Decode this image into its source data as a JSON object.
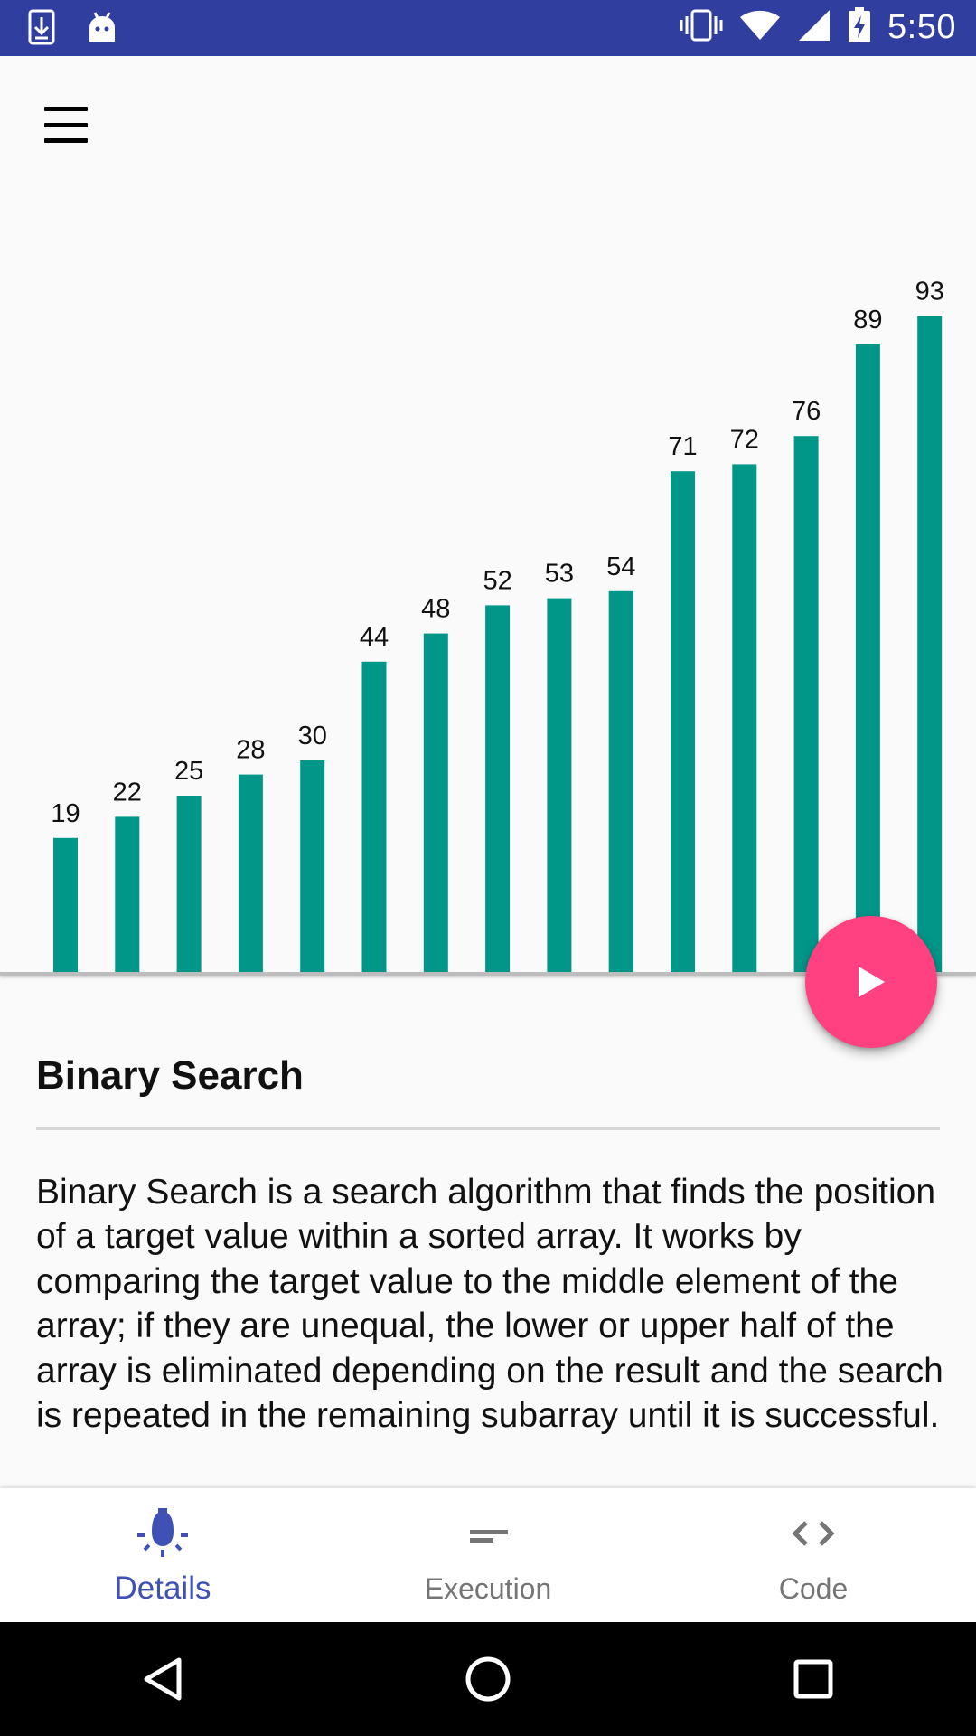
{
  "status_bar": {
    "time": "5:50",
    "icons": [
      "download-icon",
      "android-icon",
      "vibrate-icon",
      "wifi-icon",
      "signal-icon",
      "battery-charging-icon"
    ]
  },
  "app_bar": {
    "menu_icon": "menu-icon"
  },
  "chart_data": {
    "type": "bar",
    "title": "",
    "xlabel": "",
    "ylabel": "",
    "values": [
      19,
      22,
      25,
      28,
      30,
      44,
      48,
      52,
      53,
      54,
      71,
      72,
      76,
      89,
      93
    ],
    "labels": [
      "19",
      "22",
      "25",
      "28",
      "30",
      "44",
      "48",
      "52",
      "53",
      "54",
      "71",
      "72",
      "76",
      "89",
      "93"
    ],
    "bar_color": "#009688",
    "grid": false,
    "legend": "none"
  },
  "fab": {
    "icon": "play-icon",
    "color": "#ff4081"
  },
  "algorithm": {
    "title": "Binary Search",
    "description": "Binary Search is a search algorithm that finds the position of a target value within a sorted array. It works by comparing the target value to the middle element of the array; if they are unequal, the lower or upper half of the array is eliminated depending on the result and the search is repeated in the remaining subarray until it is successful."
  },
  "bottom_nav": {
    "items": [
      {
        "label": "Details",
        "icon": "bulb-icon",
        "active": true
      },
      {
        "label": "Execution",
        "icon": "execution-icon",
        "active": false
      },
      {
        "label": "Code",
        "icon": "code-icon",
        "active": false
      }
    ],
    "active_color": "#3f51b5",
    "inactive_color": "#757575"
  },
  "system_nav": {
    "buttons": [
      "back-icon",
      "home-icon",
      "recents-icon"
    ]
  }
}
